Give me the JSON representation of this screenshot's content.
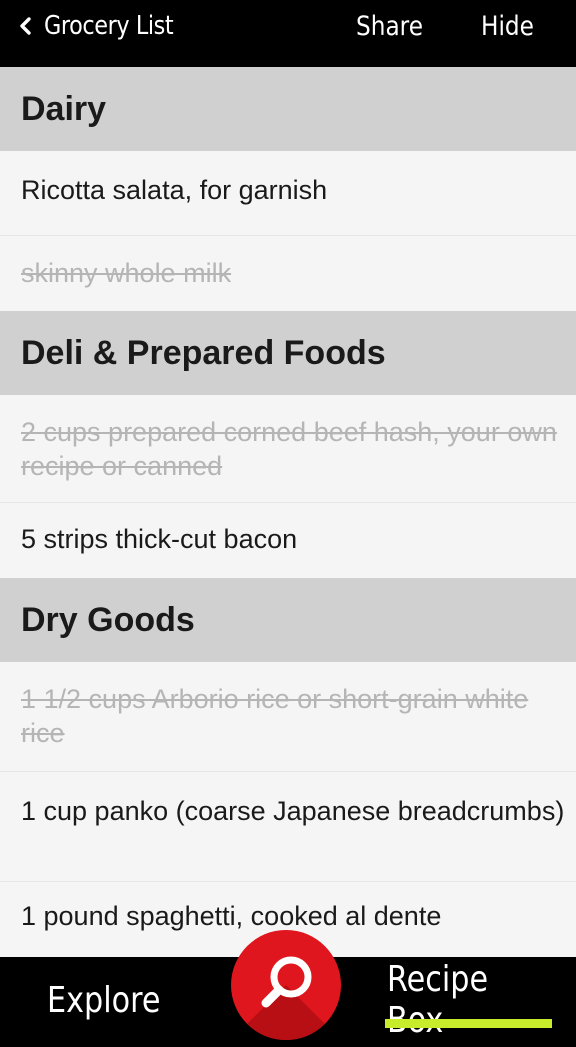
{
  "header": {
    "back_label": "Grocery List",
    "share_label": "Share",
    "hide_label": "Hide"
  },
  "sections": [
    {
      "title": "Dairy",
      "items": [
        {
          "text": "Ricotta salata, for garnish",
          "checked": false
        },
        {
          "text": "skinny whole milk",
          "checked": true
        }
      ]
    },
    {
      "title": "Deli & Prepared Foods",
      "items": [
        {
          "text": "2 cups prepared corned beef hash, your own recipe or canned",
          "checked": true
        },
        {
          "text": "5 strips thick-cut bacon",
          "checked": false
        }
      ]
    },
    {
      "title": "Dry Goods",
      "items": [
        {
          "text": "1 1/2 cups Arborio rice or short-grain white rice",
          "checked": true
        },
        {
          "text": "1 cup panko (coarse Japanese breadcrumbs)",
          "checked": false
        },
        {
          "text": "1 pound spaghetti, cooked al dente",
          "checked": false
        }
      ]
    }
  ],
  "tabbar": {
    "explore_label": "Explore",
    "recipebox_label": "Recipe Box",
    "active_tab": "Recipe Box",
    "accent_color": "#c6ec2c",
    "search_button_color": "#e0161e"
  },
  "icons": {
    "back": "chevron-left-icon",
    "search": "magnifier-icon"
  }
}
